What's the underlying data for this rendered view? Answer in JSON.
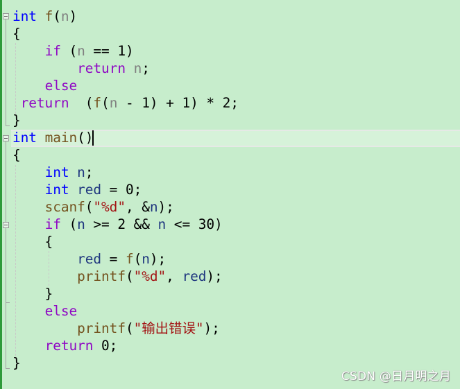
{
  "editor": {
    "lines": [
      {
        "tokens": [
          {
            "t": "int",
            "c": "kw-type"
          },
          {
            "t": " "
          },
          {
            "t": "f",
            "c": "fn"
          },
          {
            "t": "("
          },
          {
            "t": "n",
            "c": "param"
          },
          {
            "t": ")"
          }
        ]
      },
      {
        "tokens": [
          {
            "t": "{"
          }
        ]
      },
      {
        "tokens": [
          {
            "t": "    "
          },
          {
            "t": "if",
            "c": "kw-ctrl"
          },
          {
            "t": " ("
          },
          {
            "t": "n",
            "c": "param"
          },
          {
            "t": " == 1)"
          }
        ]
      },
      {
        "tokens": [
          {
            "t": "        "
          },
          {
            "t": "return",
            "c": "kw-ctrl"
          },
          {
            "t": " "
          },
          {
            "t": "n",
            "c": "param"
          },
          {
            "t": ";"
          }
        ]
      },
      {
        "tokens": [
          {
            "t": "    "
          },
          {
            "t": "else",
            "c": "kw-ctrl"
          }
        ]
      },
      {
        "tokens": [
          {
            "t": " "
          },
          {
            "t": "return",
            "c": "kw-ctrl"
          },
          {
            "t": "  ("
          },
          {
            "t": "f",
            "c": "fn"
          },
          {
            "t": "("
          },
          {
            "t": "n",
            "c": "param"
          },
          {
            "t": " - 1) + 1) * 2;"
          }
        ]
      },
      {
        "tokens": [
          {
            "t": "}"
          }
        ]
      },
      {
        "tokens": [
          {
            "t": "int",
            "c": "kw-type"
          },
          {
            "t": " "
          },
          {
            "t": "main",
            "c": "fn"
          },
          {
            "t": "()"
          }
        ]
      },
      {
        "tokens": [
          {
            "t": "{"
          }
        ]
      },
      {
        "tokens": [
          {
            "t": "    "
          },
          {
            "t": "int",
            "c": "kw-type"
          },
          {
            "t": " "
          },
          {
            "t": "n",
            "c": "local"
          },
          {
            "t": ";"
          }
        ]
      },
      {
        "tokens": [
          {
            "t": "    "
          },
          {
            "t": "int",
            "c": "kw-type"
          },
          {
            "t": " "
          },
          {
            "t": "red",
            "c": "local"
          },
          {
            "t": " = 0;"
          }
        ]
      },
      {
        "tokens": [
          {
            "t": "    "
          },
          {
            "t": "scanf",
            "c": "fn"
          },
          {
            "t": "("
          },
          {
            "t": "\"%d\"",
            "c": "str"
          },
          {
            "t": ", &"
          },
          {
            "t": "n",
            "c": "local"
          },
          {
            "t": ");"
          }
        ]
      },
      {
        "tokens": [
          {
            "t": "    "
          },
          {
            "t": "if",
            "c": "kw-ctrl"
          },
          {
            "t": " ("
          },
          {
            "t": "n",
            "c": "local"
          },
          {
            "t": " >= 2 && "
          },
          {
            "t": "n",
            "c": "local"
          },
          {
            "t": " <= 30)"
          }
        ]
      },
      {
        "tokens": [
          {
            "t": "    {"
          }
        ]
      },
      {
        "tokens": [
          {
            "t": "        "
          },
          {
            "t": "red",
            "c": "local"
          },
          {
            "t": " = "
          },
          {
            "t": "f",
            "c": "fn"
          },
          {
            "t": "("
          },
          {
            "t": "n",
            "c": "local"
          },
          {
            "t": ");"
          }
        ]
      },
      {
        "tokens": [
          {
            "t": "        "
          },
          {
            "t": "printf",
            "c": "fn"
          },
          {
            "t": "("
          },
          {
            "t": "\"%d\"",
            "c": "str"
          },
          {
            "t": ", "
          },
          {
            "t": "red",
            "c": "local"
          },
          {
            "t": ");"
          }
        ]
      },
      {
        "tokens": [
          {
            "t": "    }"
          }
        ]
      },
      {
        "tokens": [
          {
            "t": "    "
          },
          {
            "t": "else",
            "c": "kw-ctrl"
          }
        ]
      },
      {
        "tokens": [
          {
            "t": "        "
          },
          {
            "t": "printf",
            "c": "fn"
          },
          {
            "t": "("
          },
          {
            "t": "\"输出错误\"",
            "c": "str"
          },
          {
            "t": ");"
          }
        ]
      },
      {
        "tokens": [
          {
            "t": "    "
          },
          {
            "t": "return",
            "c": "kw-ctrl"
          },
          {
            "t": " 0;"
          }
        ]
      },
      {
        "tokens": [
          {
            "t": "}"
          }
        ]
      }
    ],
    "current_line": 8
  },
  "colors": {
    "background": "#c7edcc",
    "current_line": "#d6f2d9",
    "keyword_type": "#0000ff",
    "keyword_control": "#8f08c4",
    "function": "#74531f",
    "parameter": "#808080",
    "local": "#1f377f",
    "string": "#a31515"
  },
  "watermark": "CSDN @日月明之月"
}
